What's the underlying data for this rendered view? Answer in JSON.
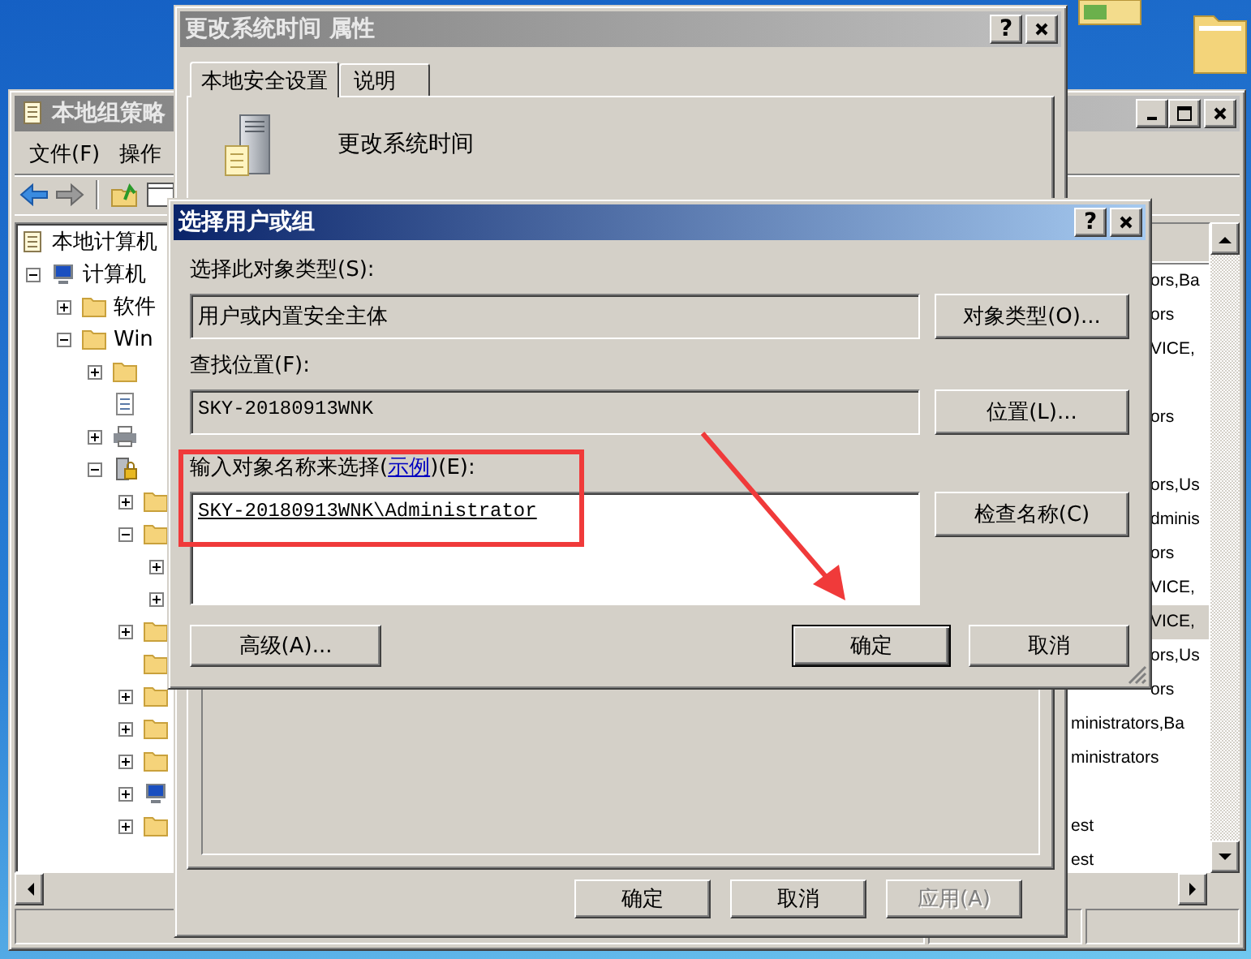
{
  "back_window": {
    "title": "本地组策略",
    "menu": [
      "文件(F)",
      "操作"
    ],
    "tree": [
      {
        "label": "本地计算机",
        "kind": "doc",
        "children": [
          {
            "label": "计算机",
            "kind": "computer",
            "expanded": true,
            "children": [
              {
                "label": "软件",
                "kind": "folder",
                "expanded": false
              },
              {
                "label": "Win",
                "kind": "folder",
                "expanded": true,
                "children": [
                  {
                    "kind": "folder",
                    "expanded": false
                  },
                  {
                    "kind": "script"
                  },
                  {
                    "kind": "printer",
                    "expanded": false
                  },
                  {
                    "kind": "security",
                    "expanded": true,
                    "children": [
                      {
                        "kind": "folder",
                        "expanded": false
                      },
                      {
                        "kind": "folder",
                        "expanded": true,
                        "children": [
                          {
                            "expanded": false
                          },
                          {
                            "expanded": false
                          }
                        ]
                      },
                      {
                        "kind": "folder",
                        "expanded": false
                      },
                      {
                        "kind": "folder"
                      },
                      {
                        "kind": "folder",
                        "expanded": false
                      },
                      {
                        "kind": "folder",
                        "expanded": false
                      },
                      {
                        "kind": "folder",
                        "expanded": false
                      },
                      {
                        "kind": "computer",
                        "expanded": false
                      },
                      {
                        "kind": "folder",
                        "expanded": false
                      }
                    ]
                  }
                ]
              }
            ]
          }
        ]
      }
    ],
    "list_rows": [
      {
        "text": "ors,Ba",
        "selected": false
      },
      {
        "text": "ors",
        "selected": false
      },
      {
        "text": "VICE,",
        "selected": false
      },
      {
        "selected": false
      },
      {
        "text": "ors",
        "selected": false
      },
      {
        "selected": false
      },
      {
        "text": "ors,Us",
        "selected": false
      },
      {
        "text": "dminis",
        "selected": false
      },
      {
        "text": "ors",
        "selected": false
      },
      {
        "text": "VICE,",
        "selected": false
      },
      {
        "text": "VICE,",
        "selected": true
      },
      {
        "text": "ors,Us",
        "selected": false
      },
      {
        "text": "ors",
        "selected": false
      },
      {
        "text": "ministrators,Ba",
        "selected": false
      },
      {
        "text": "ministrators",
        "selected": false
      },
      {
        "selected": false
      },
      {
        "text": "est",
        "selected": false
      },
      {
        "text": "est",
        "selected": false
      }
    ]
  },
  "properties_dialog": {
    "title": "更改系统时间 属性",
    "active": false,
    "help_button": "?",
    "tabs": [
      {
        "label": "本地安全设置",
        "selected": true
      },
      {
        "label": "说明",
        "selected": false
      }
    ],
    "policy_name": "更改系统时间",
    "buttons": [
      {
        "label": "确定",
        "disabled": false
      },
      {
        "label": "取消",
        "disabled": false
      },
      {
        "label": "应用(A)",
        "disabled": true
      }
    ]
  },
  "select_dialog": {
    "title": "选择用户或组",
    "active": true,
    "help_button": "?",
    "object_type_label": "选择此对象类型(S):",
    "object_type_value": "用户或内置安全主体",
    "object_type_button": "对象类型(O)...",
    "location_label": "查找位置(F):",
    "location_value": "SKY-20180913WNK",
    "location_button": "位置(L)...",
    "names_label": {
      "before": "输入对象名称来选择(",
      "link": "示例",
      "after": ")(E):"
    },
    "names_value": "SKY-20180913WNK\\Administrator",
    "check_button": "检查名称(C)",
    "advanced_button": "高级(A)...",
    "ok_button": "确定",
    "cancel_button": "取消"
  }
}
